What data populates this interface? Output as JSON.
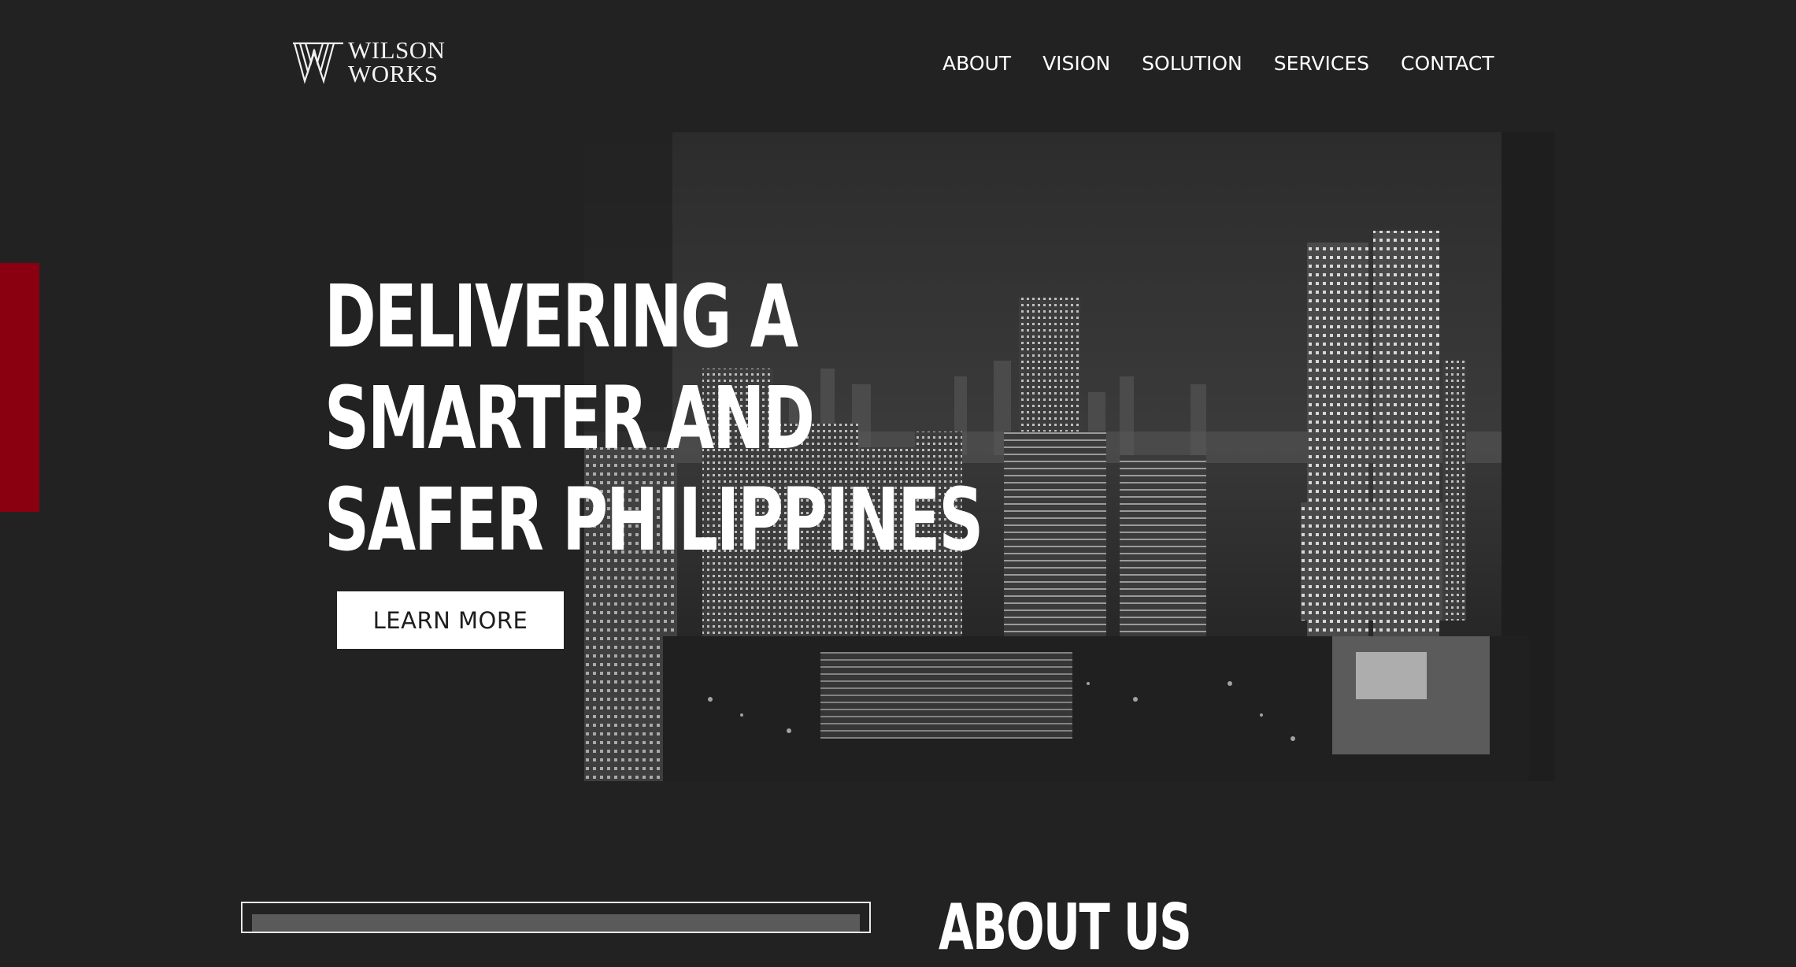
{
  "logo": {
    "line1": "WILSON",
    "line2": "WORKS",
    "icon": "w-monogram-icon"
  },
  "nav": [
    "ABOUT",
    "VISION",
    "SOLUTION",
    "SERVICES",
    "CONTACT"
  ],
  "hero": {
    "headline": [
      "DELIVERING A",
      "SMARTER AND",
      "SAFER PHILIPPINES"
    ],
    "cta_label": "LEARN MORE",
    "image": "city-skyline-night"
  },
  "about": {
    "title": "ABOUT US"
  },
  "colors": {
    "background": "#222223",
    "accent": "#8a0010",
    "text": "#ffffff"
  }
}
